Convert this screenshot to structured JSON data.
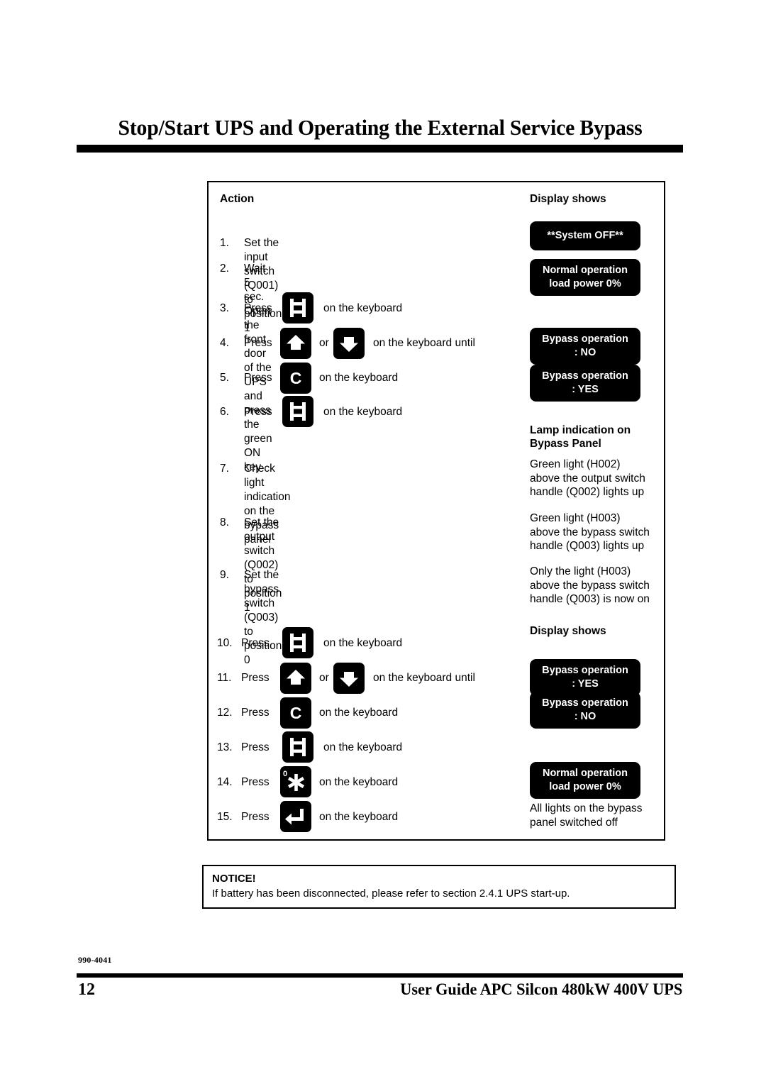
{
  "document": {
    "title": "Stop/Start UPS and Operating the External Service Bypass",
    "part_number": "990-4041",
    "page_number": "12",
    "footer_title": "User Guide APC Silcon 480kW 400V UPS"
  },
  "table": {
    "headers": {
      "action": "Action",
      "display": "Display shows",
      "lamp": "Lamp indication on\nBypass Panel",
      "display2": "Display shows"
    },
    "steps": [
      {
        "num": "1.",
        "text": "Set the input switch (Q001) to position 1",
        "icon": null,
        "tail": null
      },
      {
        "num": "2.",
        "text": "Wait 5 sec. Open the front door of the UPS and\npress the green ON key",
        "icon": null,
        "tail": null
      },
      {
        "num": "3.",
        "text": "Press",
        "icon": "frame-key-icon",
        "tail": "on the keyboard"
      },
      {
        "num": "4.",
        "text": "Press",
        "icon": "up-arrow-key-icon",
        "icon2": "down-arrow-key-icon",
        "between": "or",
        "tail": "on the keyboard until"
      },
      {
        "num": "5.",
        "text": "Press",
        "icon": "c-key-icon",
        "tail": "on the keyboard"
      },
      {
        "num": "6.",
        "text": "Press",
        "icon": "frame-key-icon",
        "tail": "on the keyboard"
      },
      {
        "num": "7.",
        "text": "Check light indication on the bypass panel",
        "icon": null,
        "tail": null
      },
      {
        "num": "8.",
        "text": "Set the output switch (Q002) to position 1",
        "icon": null,
        "tail": null
      },
      {
        "num": "9.",
        "text": "Set the bypass switch (Q003) to position 0",
        "icon": null,
        "tail": null
      },
      {
        "num": "10.",
        "text": "Press",
        "icon": "frame-key-icon",
        "tail": "on the keyboard"
      },
      {
        "num": "11.",
        "text": "Press",
        "icon": "up-arrow-key-icon",
        "icon2": "down-arrow-key-icon",
        "between": "or",
        "tail": "on the keyboard until"
      },
      {
        "num": "12.",
        "text": "Press",
        "icon": "c-key-icon",
        "tail": "on the keyboard"
      },
      {
        "num": "13.",
        "text": "Press",
        "icon": "frame-key-icon",
        "tail": "on the keyboard"
      },
      {
        "num": "14.",
        "text": "Press",
        "icon": "asterisk-zero-key-icon",
        "tail": "on the keyboard"
      },
      {
        "num": "15.",
        "text": "Press",
        "icon": "enter-key-icon",
        "tail": "on the keyboard"
      }
    ],
    "displays": [
      {
        "id": "d1",
        "text": "**System OFF**"
      },
      {
        "id": "d2",
        "text": "Normal operation\nload power 0%"
      },
      {
        "id": "d3",
        "text": "Bypass operation\n:  NO"
      },
      {
        "id": "d4",
        "text": "Bypass operation\n:  YES"
      },
      {
        "id": "d5",
        "text": "Bypass operation\n:  YES"
      },
      {
        "id": "d6",
        "text": "Bypass operation\n:  NO"
      },
      {
        "id": "d7",
        "text": "Normal operation\nload power 0%"
      }
    ],
    "lamp_texts": [
      {
        "id": "l1",
        "text": "Green light (H002)\nabove the output switch\nhandle (Q002) lights up"
      },
      {
        "id": "l2",
        "text": "Green light (H003)\nabove the bypass switch\nhandle (Q003) lights up"
      },
      {
        "id": "l3",
        "text": "Only the light (H003)\nabove the bypass switch\nhandle (Q003) is now on"
      },
      {
        "id": "l4",
        "text": "All lights on the bypass\npanel switched off"
      }
    ]
  },
  "notice": {
    "title": "NOTICE!",
    "text": "If battery has been disconnected, please refer to section 2.4.1 UPS start-up."
  },
  "colors": {
    "ink": "#000000",
    "paper": "#ffffff",
    "key_fill": "#000000",
    "key_glyph": "#ffffff"
  }
}
